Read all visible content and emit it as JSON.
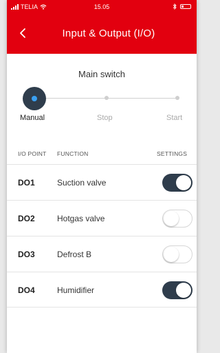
{
  "status_bar": {
    "carrier": "TELIA",
    "time": "15.05"
  },
  "header": {
    "title": "Input & Output (I/O)",
    "background_color": "#e2000f"
  },
  "main_switch": {
    "title": "Main switch",
    "positions": [
      "Manual",
      "Stop",
      "Start"
    ],
    "selected": "Manual"
  },
  "table": {
    "headers": {
      "io_point": "I/O POINT",
      "function": "FUNCTION",
      "settings": "SETTINGS"
    },
    "rows": [
      {
        "point": "DO1",
        "function": "Suction valve",
        "enabled": true
      },
      {
        "point": "DO2",
        "function": "Hotgas valve",
        "enabled": false
      },
      {
        "point": "DO3",
        "function": "Defrost B",
        "enabled": false
      },
      {
        "point": "DO4",
        "function": "Humidifier",
        "enabled": true
      }
    ]
  },
  "icons": {
    "back": "chevron-left-icon",
    "wifi": "wifi-icon",
    "bluetooth": "bluetooth-icon",
    "battery": "battery-icon",
    "signal": "signal-icon"
  }
}
